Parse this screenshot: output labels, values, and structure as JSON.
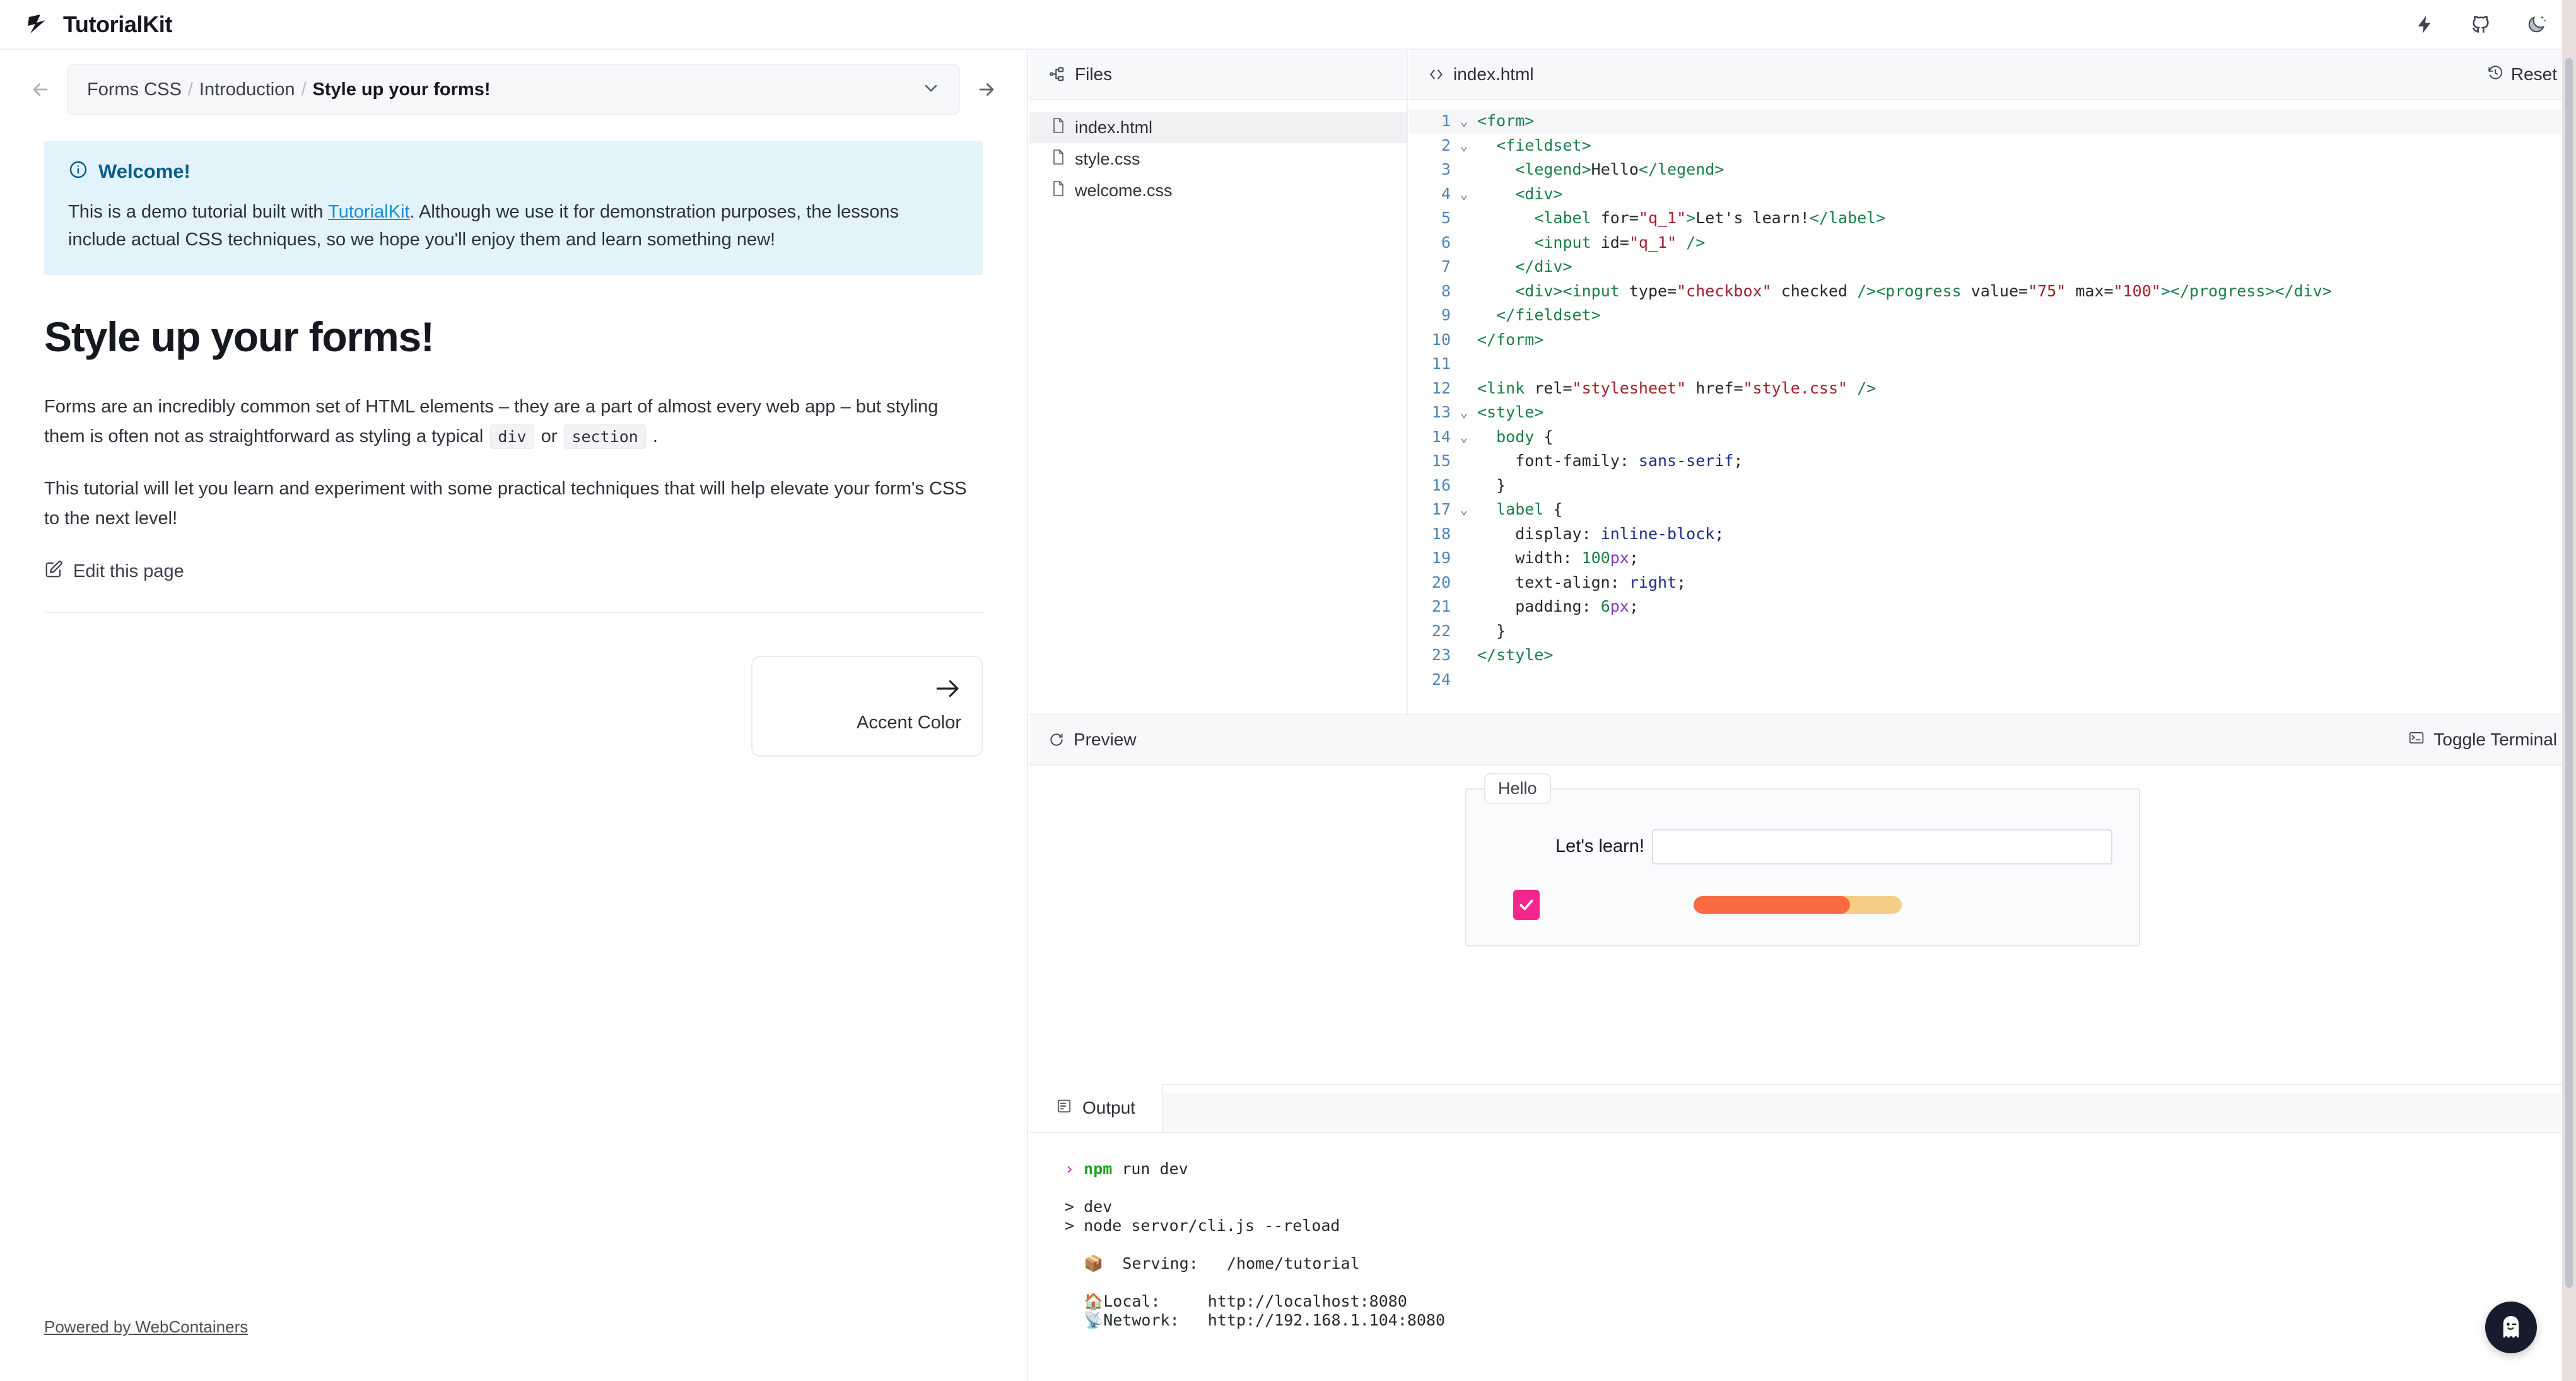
{
  "app": {
    "brand": "TutorialKit",
    "nav_icons": [
      "lightning-bolt-icon",
      "github-icon",
      "dark-mode-moon-icon"
    ]
  },
  "lesson_nav": {
    "prev_label": "previous-lesson-arrow",
    "next_label": "next-lesson-arrow",
    "breadcrumb": {
      "part": "Forms CSS",
      "chapter": "Introduction",
      "lesson": "Style up your forms!",
      "separator": "/"
    }
  },
  "callout": {
    "icon": "info-icon",
    "title": "Welcome!",
    "text_before": "This is a demo tutorial built with ",
    "link": "TutorialKit",
    "text_after": ". Although we use it for demonstration purposes, the lessons include actual CSS techniques, so we hope you'll enjoy them and learn something new!"
  },
  "lesson": {
    "title": "Style up your forms!",
    "paragraph_1_a": "Forms are an incredibly common set of HTML elements – they are a part of almost every web app – but styling them is often not as straightforward as styling a typical ",
    "code_1": "div",
    "paragraph_1_b": " or ",
    "code_2": "section",
    "paragraph_1_c": " .",
    "paragraph_2": "This tutorial will let you learn and experiment with some practical techniques that will help elevate your form's CSS to the next level!",
    "edit_link": "Edit this page",
    "next_card": {
      "label": "Accent Color",
      "arrow": "arrow-right-icon"
    }
  },
  "footer": {
    "powered_by": "Powered by WebContainers"
  },
  "files": {
    "header": "Files",
    "header_icon": "file-tree-icon",
    "items": [
      {
        "name": "index.html",
        "active": true
      },
      {
        "name": "style.css",
        "active": false
      },
      {
        "name": "welcome.css",
        "active": false
      }
    ]
  },
  "editor": {
    "tab": "index.html",
    "tab_icon": "code-brackets-icon",
    "reset_label": "Reset",
    "reset_icon": "history-reset-icon",
    "lines": [
      {
        "n": "1",
        "fold": "v",
        "tokens": [
          [
            "tag",
            "<form>"
          ]
        ]
      },
      {
        "n": "2",
        "fold": "v",
        "tokens": [
          [
            "src",
            "  "
          ],
          [
            "tag",
            "<fieldset>"
          ]
        ]
      },
      {
        "n": "3",
        "fold": "",
        "tokens": [
          [
            "src",
            "    "
          ],
          [
            "tag",
            "<legend>"
          ],
          [
            "src",
            "Hello"
          ],
          [
            "tag",
            "</legend>"
          ]
        ]
      },
      {
        "n": "4",
        "fold": "v",
        "tokens": [
          [
            "src",
            "    "
          ],
          [
            "tag",
            "<div>"
          ]
        ]
      },
      {
        "n": "5",
        "fold": "",
        "tokens": [
          [
            "src",
            "      "
          ],
          [
            "tag",
            "<label"
          ],
          [
            "src",
            " "
          ],
          [
            "attr",
            "for="
          ],
          [
            "val",
            "\"q_1\""
          ],
          [
            "tag",
            ">"
          ],
          [
            "src",
            "Let's learn!"
          ],
          [
            "tag",
            "</label>"
          ]
        ]
      },
      {
        "n": "6",
        "fold": "",
        "tokens": [
          [
            "src",
            "      "
          ],
          [
            "tag",
            "<input"
          ],
          [
            "src",
            " "
          ],
          [
            "attr",
            "id="
          ],
          [
            "val",
            "\"q_1\""
          ],
          [
            "src",
            " "
          ],
          [
            "tag",
            "/>"
          ]
        ]
      },
      {
        "n": "7",
        "fold": "",
        "tokens": [
          [
            "src",
            "    "
          ],
          [
            "tag",
            "</div>"
          ]
        ]
      },
      {
        "n": "8",
        "fold": "",
        "tokens": [
          [
            "src",
            "    "
          ],
          [
            "tag",
            "<div>"
          ],
          [
            "tag",
            "<input"
          ],
          [
            "src",
            " "
          ],
          [
            "attr",
            "type="
          ],
          [
            "val",
            "\"checkbox\""
          ],
          [
            "src",
            " checked "
          ],
          [
            "tag",
            "/>"
          ],
          [
            "tag",
            "<progress"
          ],
          [
            "src",
            " "
          ],
          [
            "attr",
            "value="
          ],
          [
            "val",
            "\"75\""
          ],
          [
            "src",
            " "
          ],
          [
            "attr",
            "max="
          ],
          [
            "val",
            "\"100\""
          ],
          [
            "tag",
            ">"
          ],
          [
            "tag",
            "</progress>"
          ],
          [
            "tag",
            "</div>"
          ]
        ]
      },
      {
        "n": "9",
        "fold": "",
        "tokens": [
          [
            "src",
            "  "
          ],
          [
            "tag",
            "</fieldset>"
          ]
        ]
      },
      {
        "n": "10",
        "fold": "",
        "tokens": [
          [
            "tag",
            "</form>"
          ]
        ]
      },
      {
        "n": "11",
        "fold": "",
        "tokens": [
          [
            "src",
            ""
          ]
        ]
      },
      {
        "n": "12",
        "fold": "",
        "tokens": [
          [
            "tag",
            "<link"
          ],
          [
            "src",
            " "
          ],
          [
            "attr",
            "rel="
          ],
          [
            "val",
            "\"stylesheet\""
          ],
          [
            "src",
            " "
          ],
          [
            "attr",
            "href="
          ],
          [
            "val",
            "\"style.css\""
          ],
          [
            "src",
            " "
          ],
          [
            "tag",
            "/>"
          ]
        ]
      },
      {
        "n": "13",
        "fold": "v",
        "tokens": [
          [
            "tag",
            "<style>"
          ]
        ]
      },
      {
        "n": "14",
        "fold": "v",
        "tokens": [
          [
            "src",
            "  "
          ],
          [
            "sel",
            "body"
          ],
          [
            "src",
            " {"
          ]
        ]
      },
      {
        "n": "15",
        "fold": "",
        "tokens": [
          [
            "src",
            "    "
          ],
          [
            "prop",
            "font-family"
          ],
          [
            "src",
            ": "
          ],
          [
            "kw",
            "sans-serif"
          ],
          [
            "src",
            ";"
          ]
        ]
      },
      {
        "n": "16",
        "fold": "",
        "tokens": [
          [
            "src",
            "  }"
          ]
        ]
      },
      {
        "n": "17",
        "fold": "v",
        "tokens": [
          [
            "src",
            "  "
          ],
          [
            "sel",
            "label"
          ],
          [
            "src",
            " {"
          ]
        ]
      },
      {
        "n": "18",
        "fold": "",
        "tokens": [
          [
            "src",
            "    "
          ],
          [
            "prop",
            "display"
          ],
          [
            "src",
            ": "
          ],
          [
            "kw",
            "inline-block"
          ],
          [
            "src",
            ";"
          ]
        ]
      },
      {
        "n": "19",
        "fold": "",
        "tokens": [
          [
            "src",
            "    "
          ],
          [
            "prop",
            "width"
          ],
          [
            "src",
            ": "
          ],
          [
            "num",
            "100"
          ],
          [
            "unit",
            "px"
          ],
          [
            "src",
            ";"
          ]
        ]
      },
      {
        "n": "20",
        "fold": "",
        "tokens": [
          [
            "src",
            "    "
          ],
          [
            "prop",
            "text-align"
          ],
          [
            "src",
            ": "
          ],
          [
            "kw",
            "right"
          ],
          [
            "src",
            ";"
          ]
        ]
      },
      {
        "n": "21",
        "fold": "",
        "tokens": [
          [
            "src",
            "    "
          ],
          [
            "prop",
            "padding"
          ],
          [
            "src",
            ": "
          ],
          [
            "num",
            "6"
          ],
          [
            "unit",
            "px"
          ],
          [
            "src",
            ";"
          ]
        ]
      },
      {
        "n": "22",
        "fold": "",
        "tokens": [
          [
            "src",
            "  }"
          ]
        ]
      },
      {
        "n": "23",
        "fold": "",
        "tokens": [
          [
            "tag",
            "</style>"
          ]
        ]
      },
      {
        "n": "24",
        "fold": "",
        "tokens": [
          [
            "src",
            ""
          ]
        ]
      }
    ]
  },
  "preview": {
    "header": "Preview",
    "header_icon": "refresh-icon",
    "toggle_terminal": "Toggle Terminal",
    "toggle_icon": "terminal-icon",
    "demo": {
      "legend": "Hello",
      "label": "Let's learn!",
      "input_value": "",
      "checkbox_checked": true,
      "checkbox_color": "#f4258f",
      "progress_value": 75,
      "progress_max": 100,
      "progress_fill_color": "#f96a41",
      "progress_track_color": "#f5cd85"
    }
  },
  "output": {
    "tab": "Output",
    "tab_icon": "terminal-output-icon",
    "terminal_lines": [
      {
        "type": "prompt",
        "cmd": "npm",
        "rest": " run dev"
      },
      {
        "type": "blank"
      },
      {
        "type": "plain",
        "text": "> dev"
      },
      {
        "type": "plain",
        "text": "> node servor/cli.js --reload"
      },
      {
        "type": "blank"
      },
      {
        "type": "plain",
        "text": "  📦  Serving:   /home/tutorial"
      },
      {
        "type": "blank"
      },
      {
        "type": "plain",
        "text": "  🏠Local:     http://localhost:8080"
      },
      {
        "type": "plain",
        "text": "  📡Network:   http://192.168.1.104:8080"
      }
    ]
  },
  "fab": {
    "icon": "ghost-icon",
    "name": "help-assistant-button"
  }
}
